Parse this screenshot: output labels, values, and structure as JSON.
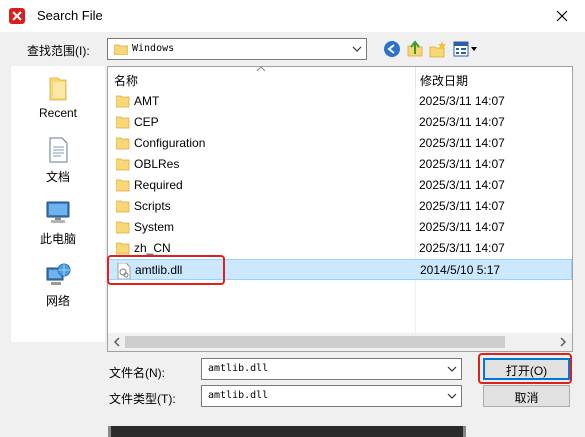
{
  "window": {
    "title": "Search File",
    "close_glyph": "✕"
  },
  "toolbar": {
    "lookin_label": "查找范围(I):",
    "lookin_value": "Windows",
    "icons": [
      "back-icon",
      "up-folder-icon",
      "new-folder-icon",
      "view-menu-icon"
    ]
  },
  "places": [
    {
      "label": "Recent",
      "icon": "recent-icon"
    },
    {
      "label": "文档",
      "icon": "documents-icon"
    },
    {
      "label": "此电脑",
      "icon": "computer-icon"
    },
    {
      "label": "网络",
      "icon": "network-icon"
    }
  ],
  "columns": {
    "name": "名称",
    "modified": "修改日期"
  },
  "files": [
    {
      "name": "AMT",
      "date": "2025/3/11 14:07",
      "type": "folder"
    },
    {
      "name": "CEP",
      "date": "2025/3/11 14:07",
      "type": "folder"
    },
    {
      "name": "Configuration",
      "date": "2025/3/11 14:07",
      "type": "folder"
    },
    {
      "name": "OBLRes",
      "date": "2025/3/11 14:07",
      "type": "folder"
    },
    {
      "name": "Required",
      "date": "2025/3/11 14:07",
      "type": "folder"
    },
    {
      "name": "Scripts",
      "date": "2025/3/11 14:07",
      "type": "folder"
    },
    {
      "name": "System",
      "date": "2025/3/11 14:07",
      "type": "folder"
    },
    {
      "name": "zh_CN",
      "date": "2025/3/11 14:07",
      "type": "folder"
    },
    {
      "name": "amtlib.dll",
      "date": "2014/5/10 5:17",
      "type": "file"
    }
  ],
  "form": {
    "filename_label": "文件名(N):",
    "filename_value": "amtlib.dll",
    "filetype_label": "文件类型(T):",
    "filetype_value": "amtlib.dll",
    "open_label": "打开(O)",
    "cancel_label": "取消"
  },
  "colors": {
    "highlight": "#e0201c",
    "selection": "#cce8ff",
    "folder": "#f8d775"
  }
}
